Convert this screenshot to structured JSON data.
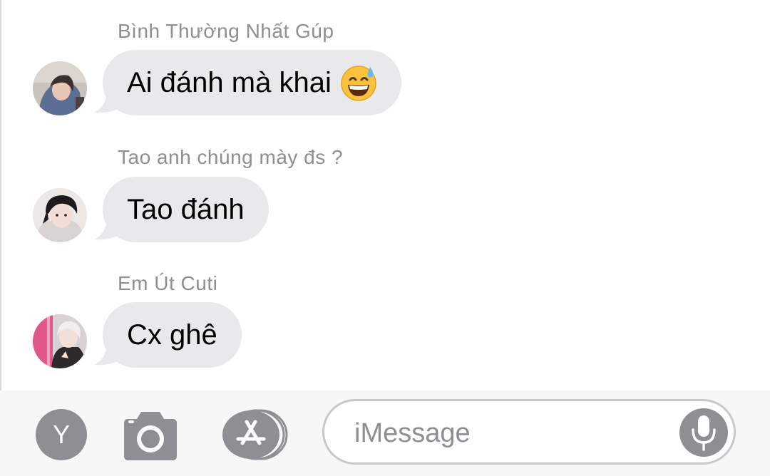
{
  "messages": [
    {
      "sender": "Bình Thường Nhất Gúp",
      "text": "Ai đánh mà khai",
      "emoji": "grinning-sweat-emoji"
    },
    {
      "sender": "Tao anh chúng mày đs ?",
      "text": "Tao đánh"
    },
    {
      "sender": "Em Út Cuti",
      "text": "Cx ghê"
    }
  ],
  "input_bar": {
    "y_label": "Y",
    "camera_icon": "camera-icon",
    "appstore_icon": "app-store-icon",
    "message_placeholder": "iMessage",
    "mic_icon": "microphone-icon"
  },
  "colors": {
    "bubble_gray": "#e9e9eb",
    "secondary_text": "#8e8e93",
    "field_border": "#c7c7cc"
  }
}
